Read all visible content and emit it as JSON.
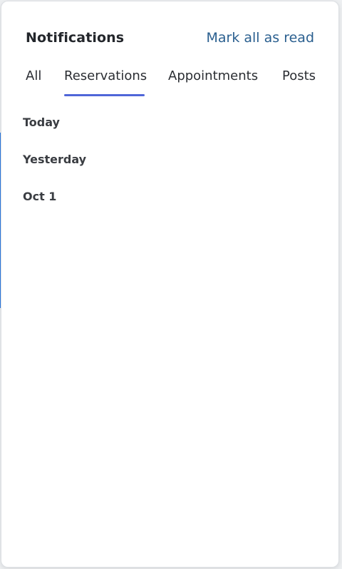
{
  "notifications": {
    "title": "Notifications",
    "mark_all_read": "Mark all as read",
    "tabs": [
      {
        "label": "All",
        "selected": false
      },
      {
        "label": "Reservations",
        "selected": true
      },
      {
        "label": "Appointments",
        "selected": false
      },
      {
        "label": "Posts",
        "selected": false
      }
    ],
    "groups": [
      {
        "label": "Today"
      },
      {
        "label": "Yesterday"
      },
      {
        "label": "Oct 1"
      }
    ]
  },
  "colors": {
    "accent_underline": "#4f66d8",
    "link": "#2a5f8f",
    "title": "#23262b"
  }
}
